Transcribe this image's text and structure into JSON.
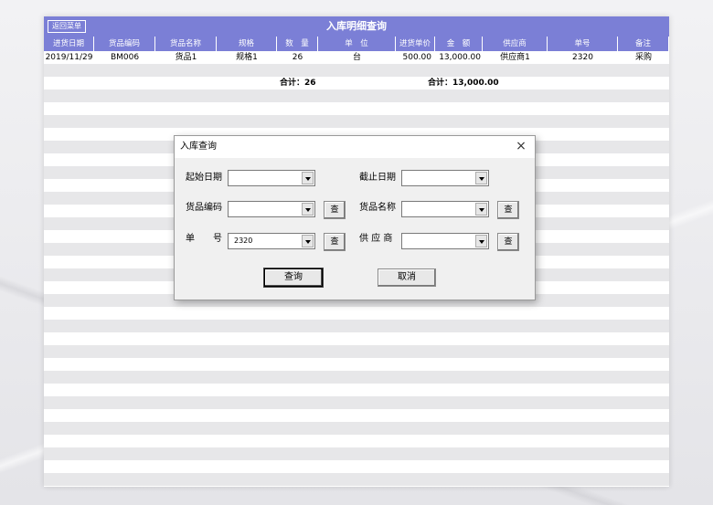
{
  "report": {
    "title": "入库明细查询",
    "back_button": "返回菜单",
    "columns": [
      "进货日期",
      "货品编码",
      "货品名称",
      "规格",
      "数　量",
      "单　位",
      "进货单价",
      "金　额",
      "供应商",
      "单号",
      "备注"
    ],
    "rows": [
      [
        "2019/11/29",
        "BM006",
        "货品1",
        "规格1",
        "26",
        "台",
        "500.00",
        "13,000.00",
        "供应商1",
        "2320",
        "采购"
      ]
    ],
    "total_qty": "合计：26",
    "total_amount": "合计：13,000.00"
  },
  "dialog": {
    "title": "入库查询",
    "close_symbol": "×",
    "labels": {
      "start_date": "起始日期",
      "end_date": "截止日期",
      "item_code": "货品编码",
      "item_name": "货品名称",
      "order_no": "单　　号",
      "supplier": "供 应 商"
    },
    "values": {
      "start_date": "",
      "end_date": "",
      "item_code": "",
      "item_name": "",
      "order_no": "2320",
      "supplier": ""
    },
    "lookup_button": "查",
    "query_button": "查询",
    "cancel_button": "取消"
  },
  "colors": {
    "header": "#7b7fd6",
    "stripe": "#e7e7e9"
  }
}
